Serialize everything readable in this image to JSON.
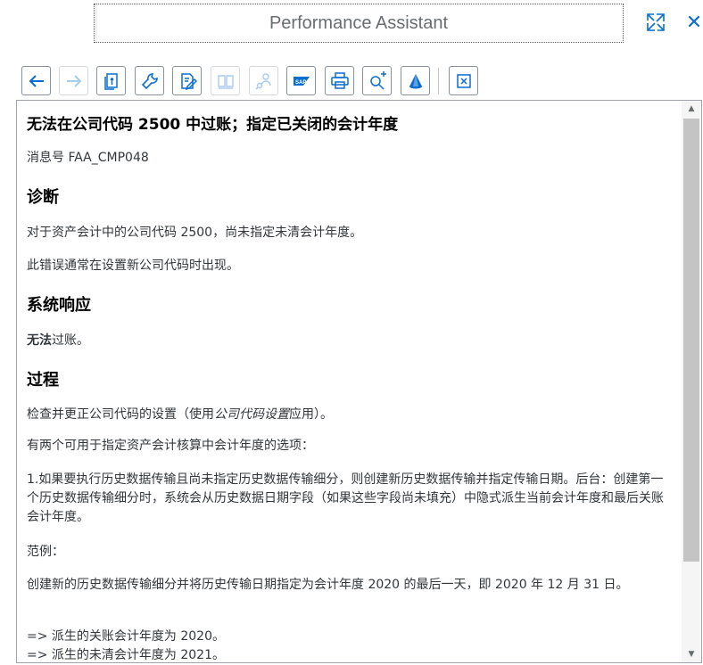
{
  "window": {
    "title": "Performance Assistant",
    "expand_icon": "expand-icon",
    "close_glyph": "✕"
  },
  "toolbar": {
    "buttons": [
      {
        "name": "back-button",
        "icon": "arrow-left-icon",
        "enabled": true
      },
      {
        "name": "forward-button",
        "icon": "arrow-right-icon",
        "enabled": false
      },
      {
        "name": "technical-info-button",
        "icon": "document-info-icon",
        "enabled": true
      },
      {
        "name": "settings-button",
        "icon": "wrench-icon",
        "enabled": true
      },
      {
        "name": "edit-button",
        "icon": "edit-document-icon",
        "enabled": true
      },
      {
        "name": "display-book-button",
        "icon": "book-icon",
        "enabled": false
      },
      {
        "name": "user-help-button",
        "icon": "person-search-icon",
        "enabled": false
      },
      {
        "name": "sap-button",
        "icon": "sap-logo-icon",
        "enabled": true,
        "label": "SAP"
      },
      {
        "name": "print-button",
        "icon": "printer-icon",
        "enabled": true
      },
      {
        "name": "zoom-in-button",
        "icon": "zoom-in-icon",
        "enabled": true
      },
      {
        "name": "highlight-button",
        "icon": "cone-icon",
        "enabled": true
      },
      {
        "name": "close-doc-button",
        "icon": "close-square-icon",
        "enabled": true
      }
    ]
  },
  "doc": {
    "heading": "无法在公司代码 2500 中过账；指定已关闭的会计年度",
    "message_no": "消息号 FAA_CMP048",
    "section_diagnosis": "诊断",
    "diagnosis_1": "对于资产会计中的公司代码 2500，尚未指定未清会计年度。",
    "diagnosis_2": "此错误通常在设置新公司代码时出现。",
    "section_response": "系统响应",
    "response_bold": "无法",
    "response_rest": "过账。",
    "section_procedure": "过程",
    "procedure_1_pre": "检查并更正公司代码的设置（使用",
    "procedure_1_em": "公司代码设置",
    "procedure_1_post": "应用）。",
    "procedure_2": "有两个可用于指定资产会计核算中会计年度的选项：",
    "procedure_3": "1.如果要执行历史数据传输且尚未指定历史数据传输细分，则创建新历史数据传输并指定传输日期。后台：创建第一个历史数据传输细分时，系统会从历史数据日期字段（如果这些字段尚未填充）中隐式派生当前会计年度和最后关账会计年度。",
    "example_label": "范例：",
    "example_1": "创建新的历史数据传输细分并将历史传输日期指定为会计年度 2020 的最后一天，即 2020 年 12 月 31 日。",
    "result_1": "=> 派生的关账会计年度为 2020。",
    "result_2": "=> 派生的未清会计年度为 2021。"
  },
  "scrollbar": {
    "up_glyph": "▲",
    "down_glyph": "▼"
  },
  "colors": {
    "accent": "#0a6ed1",
    "text": "#32363a",
    "border": "#89919a"
  }
}
